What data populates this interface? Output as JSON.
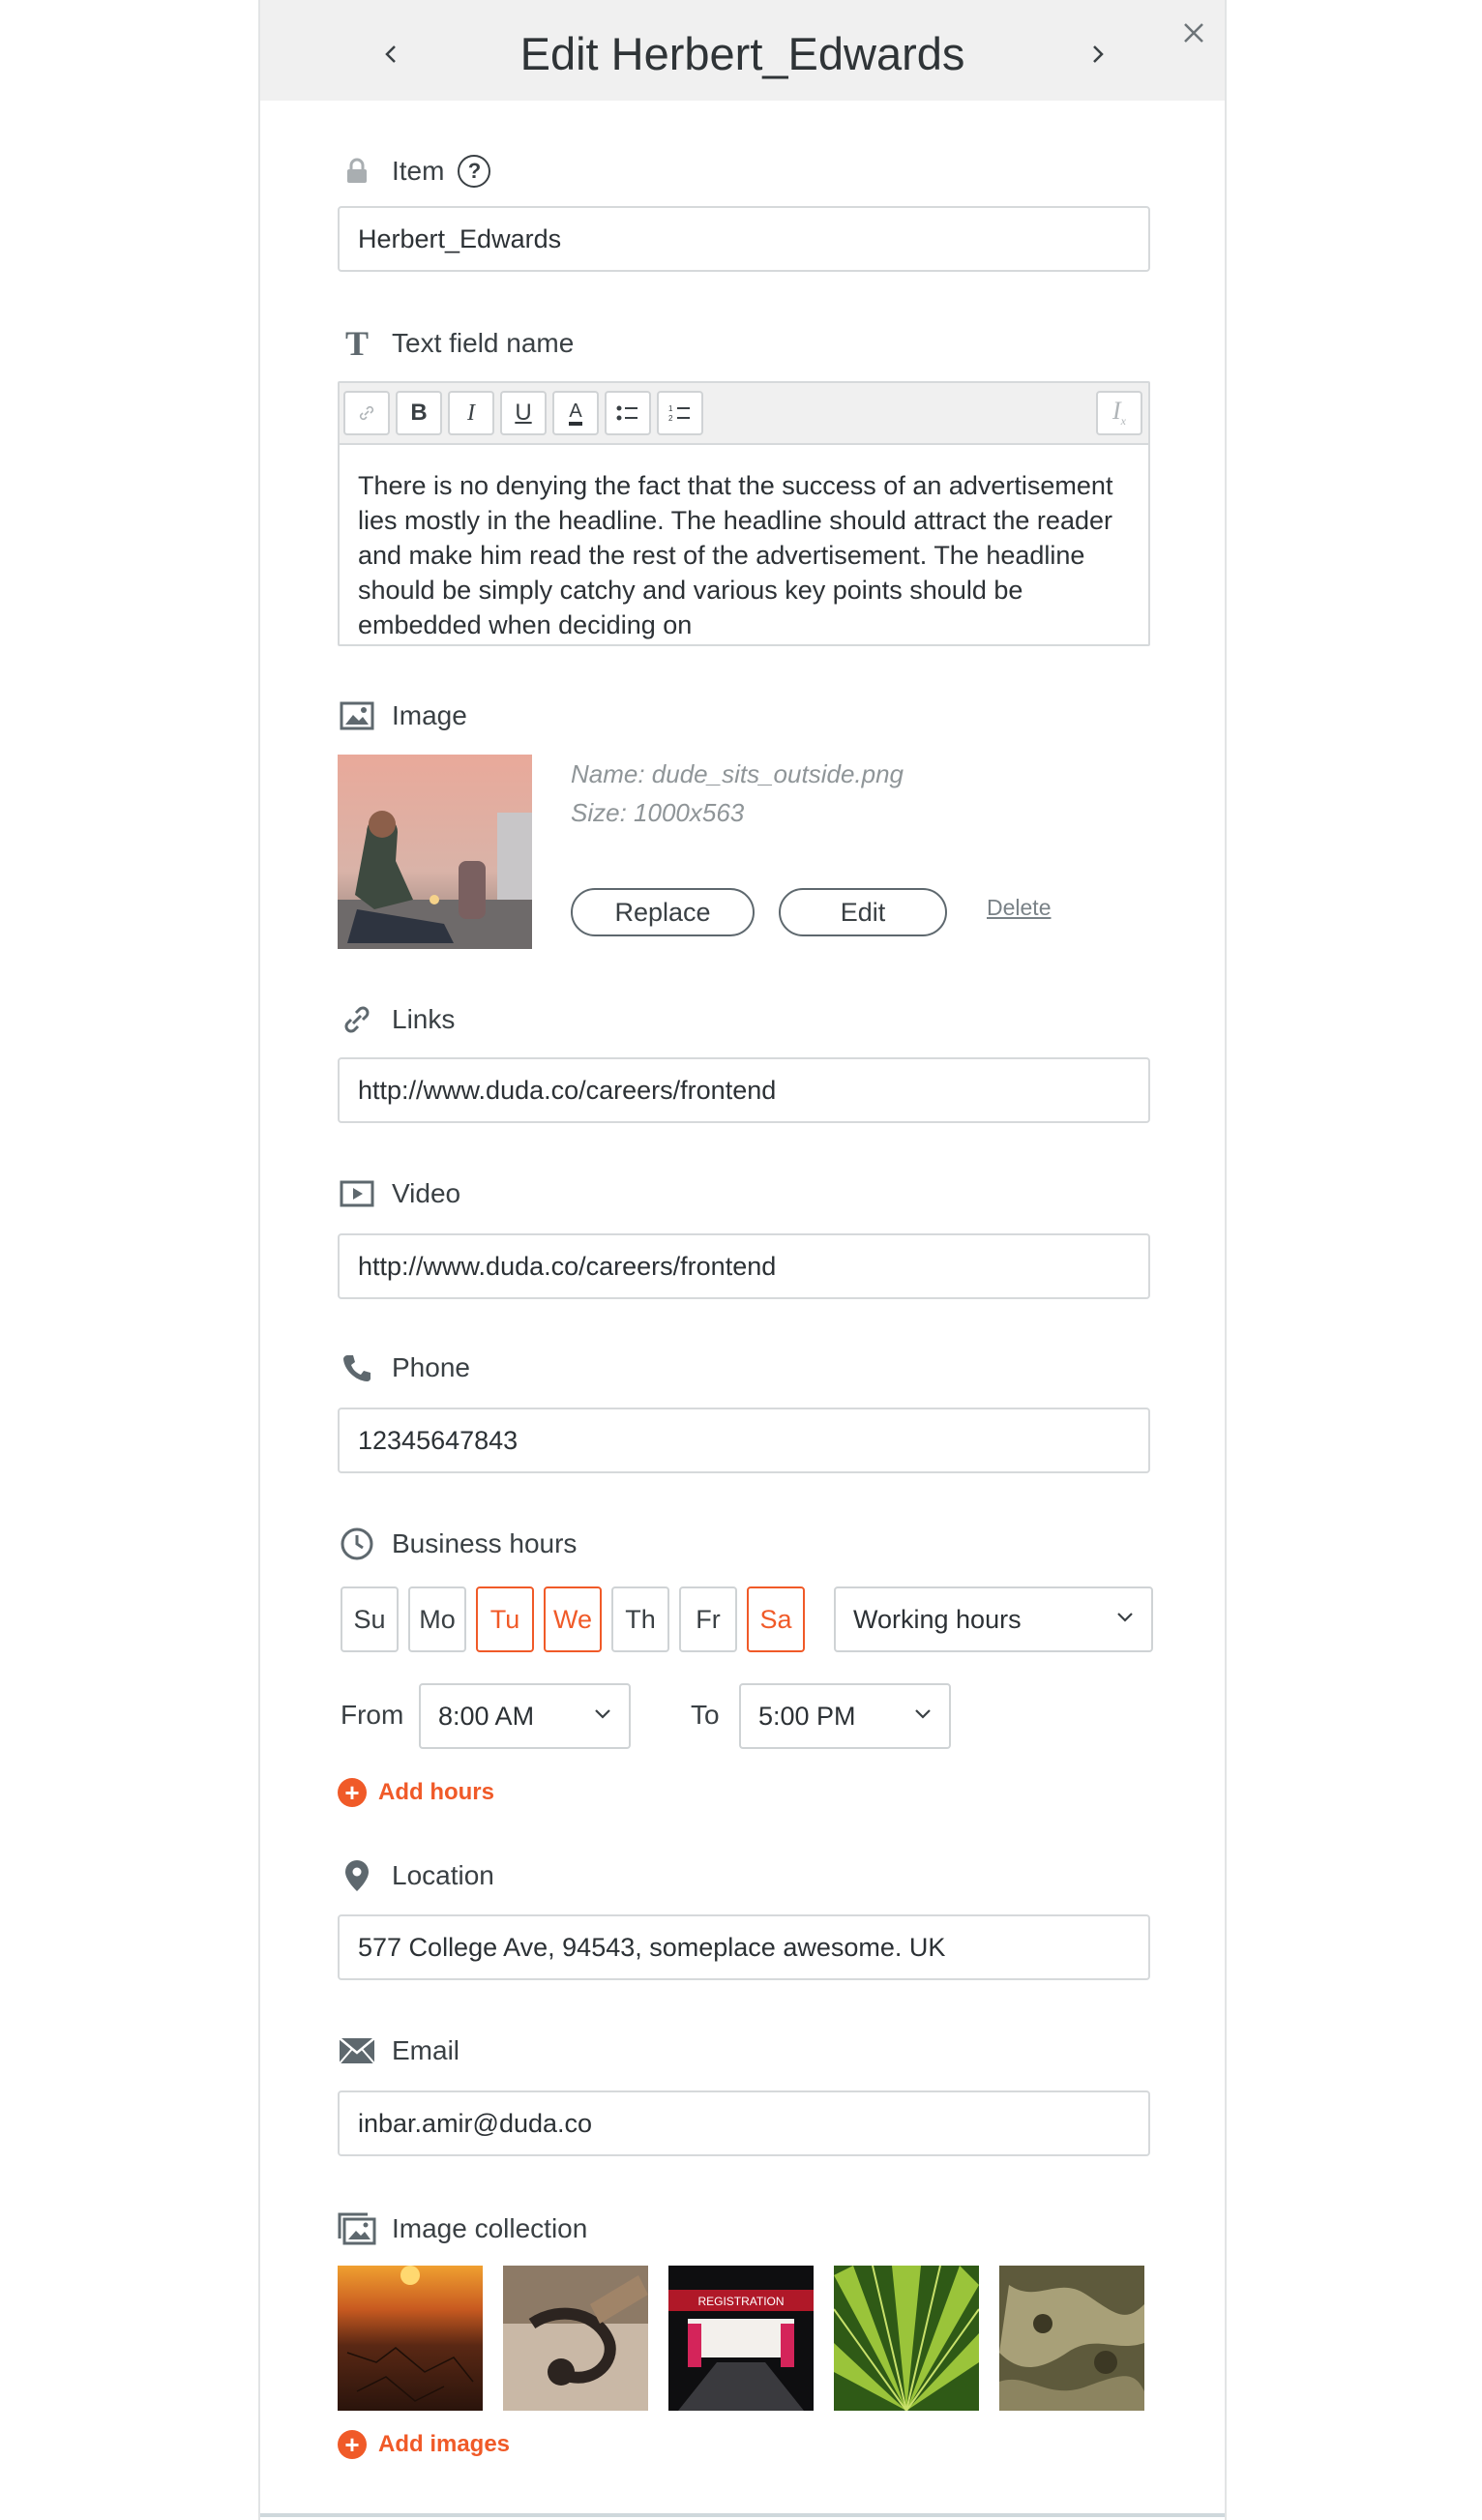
{
  "header": {
    "title": "Edit Herbert_Edwards"
  },
  "item": {
    "label": "Item",
    "value": "Herbert_Edwards"
  },
  "text_field": {
    "label": "Text field name",
    "toolbar": {
      "bold": "B",
      "italic": "I",
      "underline": "U",
      "color": "A"
    },
    "content": "There is no denying the fact that the success of an advertisement lies mostly in the headline. The headline should attract the reader and make him read the rest of the advertisement. The headline should be simply catchy and various key points should be embedded when deciding on"
  },
  "image": {
    "label": "Image",
    "name": "Name: dude_sits_outside.png",
    "size": "Size: 1000x563",
    "replace_label": "Replace",
    "edit_label": "Edit",
    "delete_label": "Delete"
  },
  "links": {
    "label": "Links",
    "value": "http://www.duda.co/careers/frontend"
  },
  "video": {
    "label": "Video",
    "value": "http://www.duda.co/careers/frontend"
  },
  "phone": {
    "label": "Phone",
    "value": "12345647843"
  },
  "business_hours": {
    "label": "Business hours",
    "days": [
      {
        "label": "Su",
        "active": false
      },
      {
        "label": "Mo",
        "active": false
      },
      {
        "label": "Tu",
        "active": true
      },
      {
        "label": "We",
        "active": true
      },
      {
        "label": "Th",
        "active": false
      },
      {
        "label": "Fr",
        "active": false
      },
      {
        "label": "Sa",
        "active": true
      }
    ],
    "mode": "Working hours",
    "from_label": "From",
    "from_value": "8:00 AM",
    "to_label": "To",
    "to_value": "5:00 PM",
    "add_hours_label": "Add hours"
  },
  "location": {
    "label": "Location",
    "value": "577 College Ave, 94543, someplace awesome. UK"
  },
  "email": {
    "label": "Email",
    "value": "inbar.amir@duda.co"
  },
  "image_collection": {
    "label": "Image collection",
    "add_images_label": "Add images"
  },
  "colors": {
    "accent": "#f05a28",
    "header_bg": "#f0f0f0",
    "icon": "#5e686e"
  }
}
